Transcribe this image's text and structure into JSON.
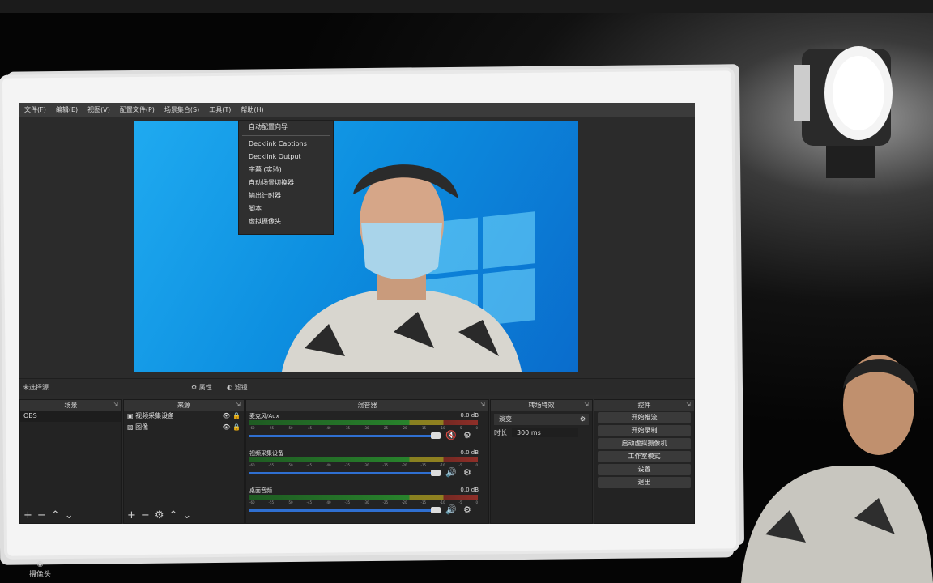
{
  "menu": [
    "文件(F)",
    "编辑(E)",
    "视图(V)",
    "配置文件(P)",
    "场景集合(S)",
    "工具(T)",
    "帮助(H)"
  ],
  "tools_menu": {
    "items": [
      "自动配置向导",
      "Decklink Captions",
      "Decklink Output",
      "字幕 (实验)",
      "自动场景切换器",
      "输出计时器",
      "脚本",
      "虚拟摄像头"
    ]
  },
  "context_bar": {
    "no_source": "未选择源",
    "properties": "属性",
    "filters": "滤镜"
  },
  "scenes": {
    "title": "场景",
    "items": [
      "OBS"
    ]
  },
  "sources": {
    "title": "来源",
    "items": [
      "视频采集设备",
      "图像"
    ]
  },
  "mixer": {
    "title": "混音器",
    "channels": [
      {
        "name": "麦克风/Aux",
        "db": "0.0 dB",
        "muted": true
      },
      {
        "name": "视频采集设备",
        "db": "0.0 dB",
        "muted": false
      },
      {
        "name": "桌面音频",
        "db": "0.0 dB",
        "muted": false
      }
    ],
    "ticks": [
      "-60",
      "-55",
      "-50",
      "-45",
      "-40",
      "-35",
      "-30",
      "-25",
      "-20",
      "-15",
      "-10",
      "-5",
      "0"
    ]
  },
  "transitions": {
    "title": "转场特效",
    "type": "淡变",
    "duration_label": "时长",
    "duration_value": "300 ms"
  },
  "controls": {
    "title": "控件",
    "buttons": [
      "开始推流",
      "开始录制",
      "启动虚拟摄像机",
      "工作室模式",
      "设置",
      "退出"
    ]
  },
  "taskbar": {
    "camera_label": "摄像头"
  },
  "colors": {
    "obs_bg": "#2b2b2b",
    "preview_blue": "#0d8fe0",
    "muted_red": "#d03030"
  }
}
